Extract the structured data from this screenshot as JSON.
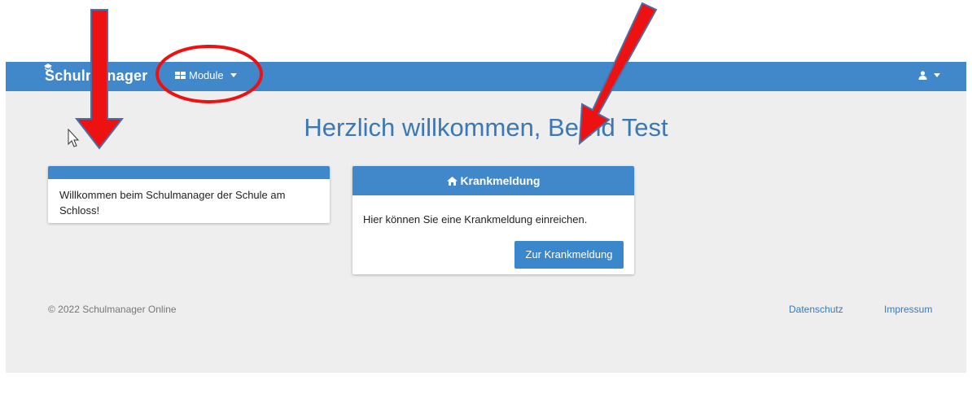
{
  "navbar": {
    "brand": "Schulmanager",
    "module_label": "Module"
  },
  "main": {
    "title": "Herzlich willkommen, Bernd Test"
  },
  "welcome_card": {
    "text": "Willkommen beim Schulmanager der Schule am Schloss!"
  },
  "sick_card": {
    "header": "Krankmeldung",
    "text": "Hier können Sie eine Krankmeldung einreichen.",
    "button": "Zur Krankmeldung"
  },
  "footer": {
    "copyright": "© 2022 Schulmanager Online",
    "privacy": "Datenschutz",
    "imprint": "Impressum"
  },
  "colors": {
    "primary": "#4088c9",
    "title": "#3b78b4",
    "background": "#eeeeee",
    "annotation": "#ee1111"
  },
  "icons": [
    "graduation-cap-icon",
    "grid-icon",
    "user-icon",
    "home-icon",
    "mouse-cursor-icon"
  ]
}
